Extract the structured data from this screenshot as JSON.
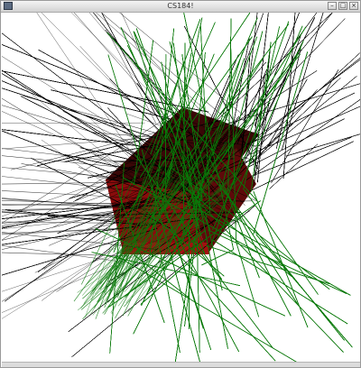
{
  "window": {
    "title": "CS184!",
    "minimize_symbol": "–",
    "maximize_symbol": "□",
    "close_symbol": "×"
  },
  "icons": {
    "app": "app-window-icon",
    "minimize": "minimize-icon",
    "maximize": "maximize-icon",
    "close": "close-icon"
  },
  "scene": {
    "background": "#ffffff",
    "box_dark": "#3a0707",
    "box_face": "#8a0c0c",
    "box_floor": "#a31010",
    "ray_black": "#000000",
    "ray_green": "#0b7a0b"
  }
}
